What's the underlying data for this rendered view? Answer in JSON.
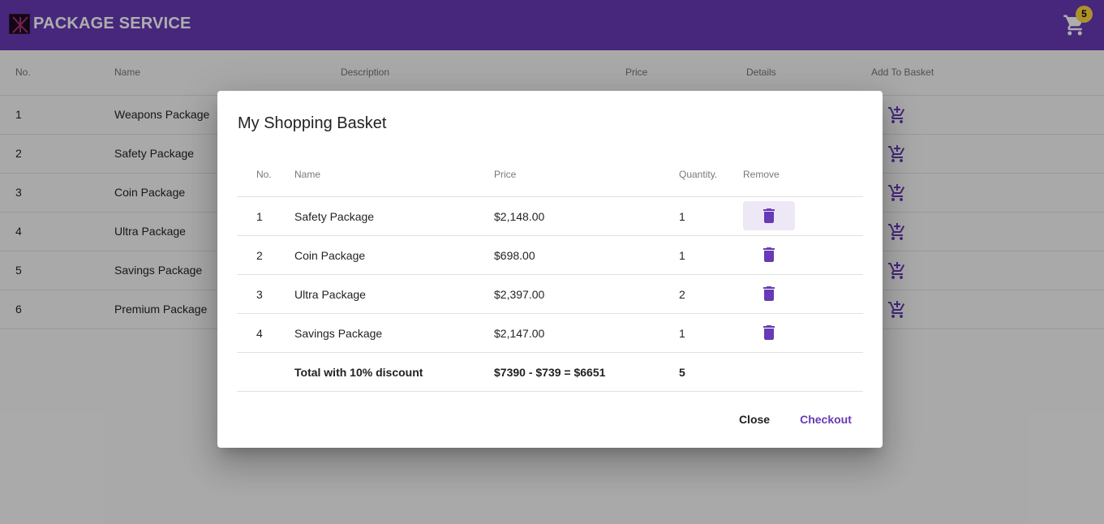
{
  "app": {
    "title": "PACKAGE SERVICE",
    "cart_count": "5"
  },
  "colors": {
    "primary": "#673ab7",
    "badge": "#ffd740"
  },
  "packages_table": {
    "headers": {
      "no": "No.",
      "name": "Name",
      "description": "Description",
      "price": "Price",
      "details": "Details",
      "add": "Add To Basket"
    },
    "rows": [
      {
        "no": "1",
        "name": "Weapons Package"
      },
      {
        "no": "2",
        "name": "Safety Package"
      },
      {
        "no": "3",
        "name": "Coin Package"
      },
      {
        "no": "4",
        "name": "Ultra Package"
      },
      {
        "no": "5",
        "name": "Savings Package"
      },
      {
        "no": "6",
        "name": "Premium Package"
      }
    ]
  },
  "dialog": {
    "title": "My Shopping Basket",
    "headers": {
      "no": "No.",
      "name": "Name",
      "price": "Price",
      "quantity": "Quantity.",
      "remove": "Remove"
    },
    "items": [
      {
        "no": "1",
        "name": "Safety Package",
        "price": "$2,148.00",
        "quantity": "1"
      },
      {
        "no": "2",
        "name": "Coin Package",
        "price": "$698.00",
        "quantity": "1"
      },
      {
        "no": "3",
        "name": "Ultra Package",
        "price": "$2,397.00",
        "quantity": "2"
      },
      {
        "no": "4",
        "name": "Savings Package",
        "price": "$2,147.00",
        "quantity": "1"
      }
    ],
    "total": {
      "label": "Total with 10% discount",
      "price": "$7390 - $739 = $6651",
      "quantity": "5"
    },
    "close_label": "Close",
    "checkout_label": "Checkout"
  }
}
